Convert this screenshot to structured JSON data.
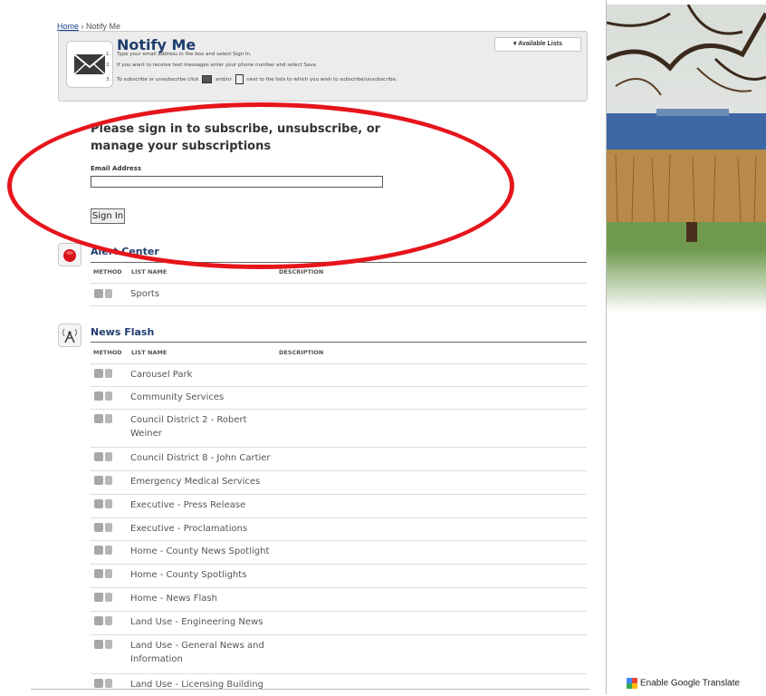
{
  "breadcrumb": {
    "home": "Home",
    "separator": "›",
    "current": "Notify Me"
  },
  "notify": {
    "title": "Notify Me",
    "available_lists": "Available Lists",
    "instructions": [
      {
        "num": "1.",
        "text": "Type your email address in the box and select Sign In."
      },
      {
        "num": "2.",
        "text": "If you want to receive text messages enter your phone number and select Save."
      },
      {
        "num": "3.",
        "text": "To subscribe or unsubscribe click",
        "text2": "and/or",
        "text3": "next to the lists to which you wish to subscribe/unsubscribe."
      }
    ]
  },
  "signin": {
    "heading": "Please sign in to subscribe, unsubscribe, or manage your subscriptions",
    "email_label": "Email Address",
    "email_value": "",
    "button": "Sign In"
  },
  "columns": {
    "method": "METHOD",
    "list_name": "LIST NAME",
    "description": "DESCRIPTION"
  },
  "sections": [
    {
      "title": "Alert Center",
      "items": [
        "Sports"
      ]
    },
    {
      "title": "News Flash",
      "items": [
        "Carousel Park",
        "Community Services",
        "Council District 2 - Robert Weiner",
        "Council District 8 - John Cartier",
        "Emergency Medical Services",
        "Executive - Press Release",
        "Executive - Proclamations",
        "Home - County News Spotlight",
        "Home - County Spotlights",
        "Home - News Flash",
        "Land Use - Engineering News",
        "Land Use - General News and Information",
        "Land Use - Licensing Building"
      ]
    }
  ],
  "translate": {
    "label": "Enable Google Translate"
  },
  "colors": {
    "accent": "#1f3d6e",
    "annotation": "#e6151c"
  }
}
